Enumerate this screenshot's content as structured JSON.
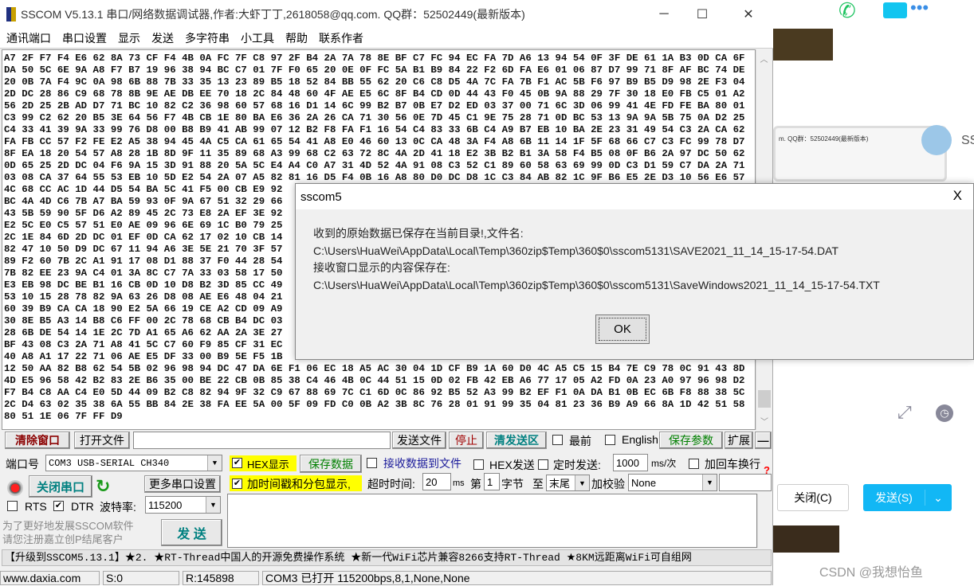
{
  "window": {
    "title": "SSCOM V5.13.1 串口/网络数据调试器,作者:大虾丁丁,2618058@qq.com. QQ群：52502449(最新版本)",
    "minimize": "─",
    "maximize": "☐",
    "close": "✕"
  },
  "menu": [
    "通讯端口",
    "串口设置",
    "显示",
    "发送",
    "多字符串",
    "小工具",
    "帮助",
    "联系作者"
  ],
  "receive_lines": [
    "A7 2F F7 F4 E6 62 8A 73 CF F4 4B 0A FC 7F C8 97 2F B4 2A 7A 78 8E BF C7 FC 94 EC FA 7D A6 13 94 54 0F 3F DE 61 1A B3 0D CA 6F",
    "DA 50 5C 6E 9A A8 F7 B7 19 96 38 94 BC C7 01 7F F0 65 20 0E 0F FC 5A B1 B9 84 22 F2 6D FA E6 01 06 87 D7 99 71 8F AF BC 74 DE",
    "20 0B 7A F4 9C 0A 98 6B 88 7B 33 35 13 23 89 B5 18 52 84 BB 55 62 20 C6 C8 D5 4A 7C FA 7B F1 AC 5B F6 97 B9 B5 D9 98 2E F3 04",
    "2D DC 28 86 C9 68 78 8B 9E AE DB EE 70 18 2C 84 48 60 4F AE E5 6C 8F B4 CD 0D 44 43 F0 45 0B 9A 88 29 7F 30 18 E0 FB C5 01 A2",
    "56 2D 25 2B AD D7 71 BC 10 82 C2 36 98 60 57 68 16 D1 14 6C 99 B2 B7 0B E7 D2 ED 03 37 00 71 6C 3D 06 99 41 4E FD FE BA 80 01",
    "C3 99 C2 62 20 B5 3E 64 56 F7 4B CB 1E 80 BA E6 36 2A 26 CA 71 30 56 0E 7D 45 C1 9E 75 28 71 0D BC 53 13 9A 9A 5B 75 0A D2 25",
    "C4 33 41 39 9A 33 99 76 D8 00 B8 B9 41 AB 99 07 12 B2 F8 FA F1 16 54 C4 83 33 6B C4 A9 B7 EB 10 BA 2E 23 31 49 54 C3 2A CA 62",
    "FA FB CC 57 F2 FE E2 A5 38 94 45 4A C5 CA 61 65 54 41 A8 E0 46 60 13 0C CA 48 3A F4 A8 6B 11 14 1F 5F 68 66 C7 C3 FC 99 78 D7",
    "8F EA 18 20 54 57 A8 28 1B 8D 9F 11 35 89 68 A3 99 68 C2 63 72 8C 4A 2D 41 18 E2 3B B2 B1 3A 58 F4 B5 08 0F B6 2A 97 DC 50 62",
    "0D 65 25 2D DC 04 F6 9A 15 3D 91 88 20 5A 5C E4 A4 C0 A7 31 4D 52 4A 91 08 C3 52 C1 89 60 58 63 69 99 0D C3 D1 59 C7 DA 2A 71",
    "03 08 CA 37 64 55 53 EB 10 5D E2 54 2A 07 A5 82 81 16 D5 F4 0B 16 A8 80 D0 DC D8 1C C3 84 AB 82 1C 9F B6 E5 2E D3 10 56 E6 57",
    "4C 68 CC AC 1D 44 D5 54 BA 5C 41 F5 00 CB E9 92",
    "BC 4A 4D C6 7B A7 BA 59 93 0F 9A 67 51 32 29 66",
    "43 5B 59 90 5F D6 A2 89 45 2C 73 E8 2A EF 3E 92",
    "E2 5C E0 C5 57 51 E0 AE 09 96 6E 69 1C B0 79 25",
    "2C 1E 84 6D 2D DC 01 EF 0D CA 62 17 02 10 CB 14",
    "82 47 10 50 D9 DC 67 11 94 A6 3E 5E 21 70 3F 57",
    "89 F2 60 7B 2C A1 91 17 08 D1 88 37 F0 44 28 54",
    "7B 82 EE 23 9A C4 01 3A 8C C7 7A 33 03 58 17 50",
    "E3 EB 98 DC BE B1 16 CB 0D 10 D8 B2 3D 85 CC 49",
    "53 10 15 28 78 82 9A 63 26 D8 08 AE E6 48 04 21",
    "60 39 B9 CA CA 18 90 E2 5A 66 19 CE A2 CD 09 A9",
    "30 8E B5 A3 14 B8 C6 FF 00 2C 78 68 CB B4 DC 03",
    "28 6B DE 54 14 1E 2C 7D A1 65 A6 62 AA 2A 3E 27",
    "BF 43 08 C3 2A 71 A8 41 5C C7 60 F9 85 CF 31 EC",
    "40 A8 A1 17 22 71 06 AE E5 DF 33 00 B9 5E F5 1B",
    "12 50 AA 82 B8 62 54 5B 02 96 98 94 DC 47 DA 6E F1 06 EC 18 A5 AC 30 04 1D CF B9 1A 60 D0 4C A5 C5 15 B4 7E C9 78 0C 91 43 8D",
    "4D E5 96 58 42 B2 83 2E B6 35 00 BE 22 CB 0B 85 38 C4 46 4B 0C 44 51 15 0D 02 FB 42 EB A6 77 17 05 A2 FD 0A 23 A0 97 96 98 D2",
    "F7 B4 C8 AA C4 E0 5D 44 09 B2 C8 82 94 9F 32 C9 67 88 69 7C C1 6D 0C 86 92 B5 52 A3 99 B2 EF F1 0A DA B1 0B EC 6B F8 88 38 5C",
    "2C D4 63 02 35 38 6A 55 BB 84 2E 38 FA EE 5A 00 5F 09 FD C0 0B A2 3B 8C 76 28 01 91 99 35 04 81 23 36 B9 A9 66 8A 1D 42 51 58",
    "80 51 1E 06 7F FF D9"
  ],
  "toolbar": {
    "clear": "清除窗口",
    "open_file": "打开文件",
    "send_file": "发送文件",
    "stop": "停止",
    "clear_send": "清发送区",
    "topmost": "最前",
    "english": "English",
    "save_params": "保存参数",
    "expand": "扩展",
    "collapse": "—"
  },
  "port": {
    "label": "端口号",
    "value": "COM3 USB-SERIAL CH340",
    "close_port": "关闭串口",
    "more_settings": "更多串口设置",
    "rts": "RTS",
    "dtr": "DTR",
    "baud_label": "波特率:",
    "baud": "115200",
    "promo1": "为了更好地发展SSCOM软件",
    "promo2": "请您注册嘉立创P结尾客户",
    "send": "发 送"
  },
  "options": {
    "hex_display": "HEX显示",
    "save_data": "保存数据",
    "recv_to_file": "接收数据到文件",
    "hex_send": "HEX发送",
    "timed_send": "定时发送:",
    "interval": "1000",
    "interval_unit": "ms/次",
    "add_crlf": "加回车换行",
    "timestamp": "加时间戳和分包显示,",
    "timeout_label": "超时时间:",
    "timeout": "20",
    "timeout_unit": "ms",
    "byte_from_label": "第",
    "byte_from": "1",
    "byte_label": "字节",
    "to_label": "至",
    "to_value": "末尾",
    "checksum_label": "加校验",
    "checksum": "None",
    "help": "?"
  },
  "ticker": "【升级到SSCOM5.13.1】★2. ★RT-Thread中国人的开源免费操作系统 ★新一代WiFi芯片兼容8266支持RT-Thread ★8KM远距离WiFi可自组网",
  "status": {
    "site": "www.daxia.com",
    "sent": "S:0",
    "received": "R:145898",
    "port_status": "COM3 已打开  115200bps,8,1,None,None"
  },
  "dialog": {
    "title": "sscom5",
    "close": "X",
    "line1": "收到的原始数据已保存在当前目录!,文件名:",
    "line2": "C:\\Users\\HuaWei\\AppData\\Local\\Temp\\360zip$Temp\\360$0\\sscom5131\\SAVE2021_11_14_15-17-54.DAT",
    "line3": "接收窗口显示的内容保存在:",
    "line4": "C:\\Users\\HuaWei\\AppData\\Local\\Temp\\360zip$Temp\\360$0\\sscom5131\\SaveWindows2021_11_14_15-17-54.TXT",
    "ok": "OK"
  },
  "chat": {
    "close": "关闭(C)",
    "send": "发送(S)",
    "thumb_title": "m. QQ群：52502449(最新版本)",
    "side_text": "SS",
    "watermark": "CSDN @我想怡鱼"
  },
  "colors": {
    "accent": "#12b7f5",
    "hex_highlight": "#ffff00",
    "clear_btn": "#8b0000",
    "green": "#008000"
  }
}
